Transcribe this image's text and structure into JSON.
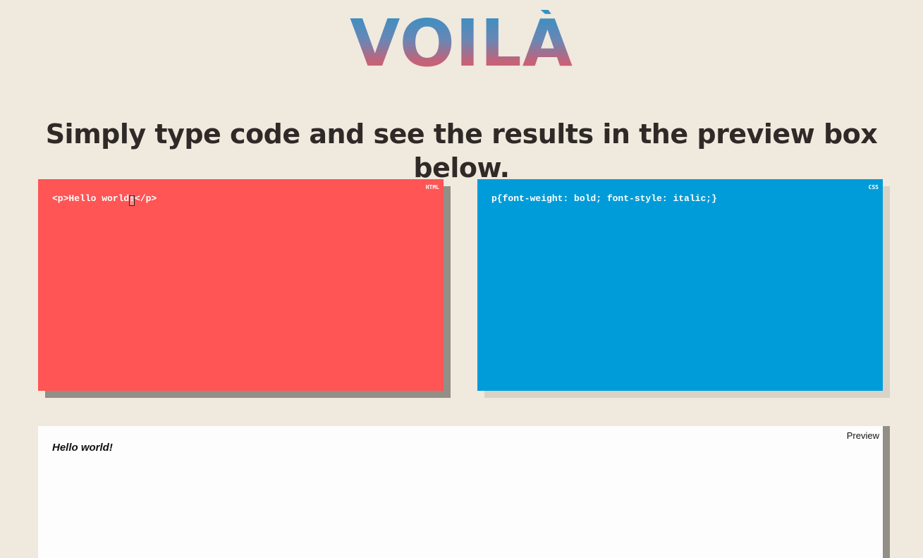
{
  "header": {
    "logo_text": "VOILÀ",
    "tagline": "Simply type code and see the results in the preview box below."
  },
  "html_editor": {
    "label": "HTML",
    "code": "<p>Hello world!</p>",
    "color": "#ff5555"
  },
  "css_editor": {
    "label": "CSS",
    "code": "p{font-weight: bold; font-style: italic;}",
    "color": "#009cd9"
  },
  "preview": {
    "label": "Preview",
    "content": "Hello world!"
  },
  "colors": {
    "background": "#f0e9de",
    "logo_gradient_top": "#2f92c6",
    "logo_gradient_bottom": "#dd5f72",
    "tagline": "#2f2a27"
  }
}
